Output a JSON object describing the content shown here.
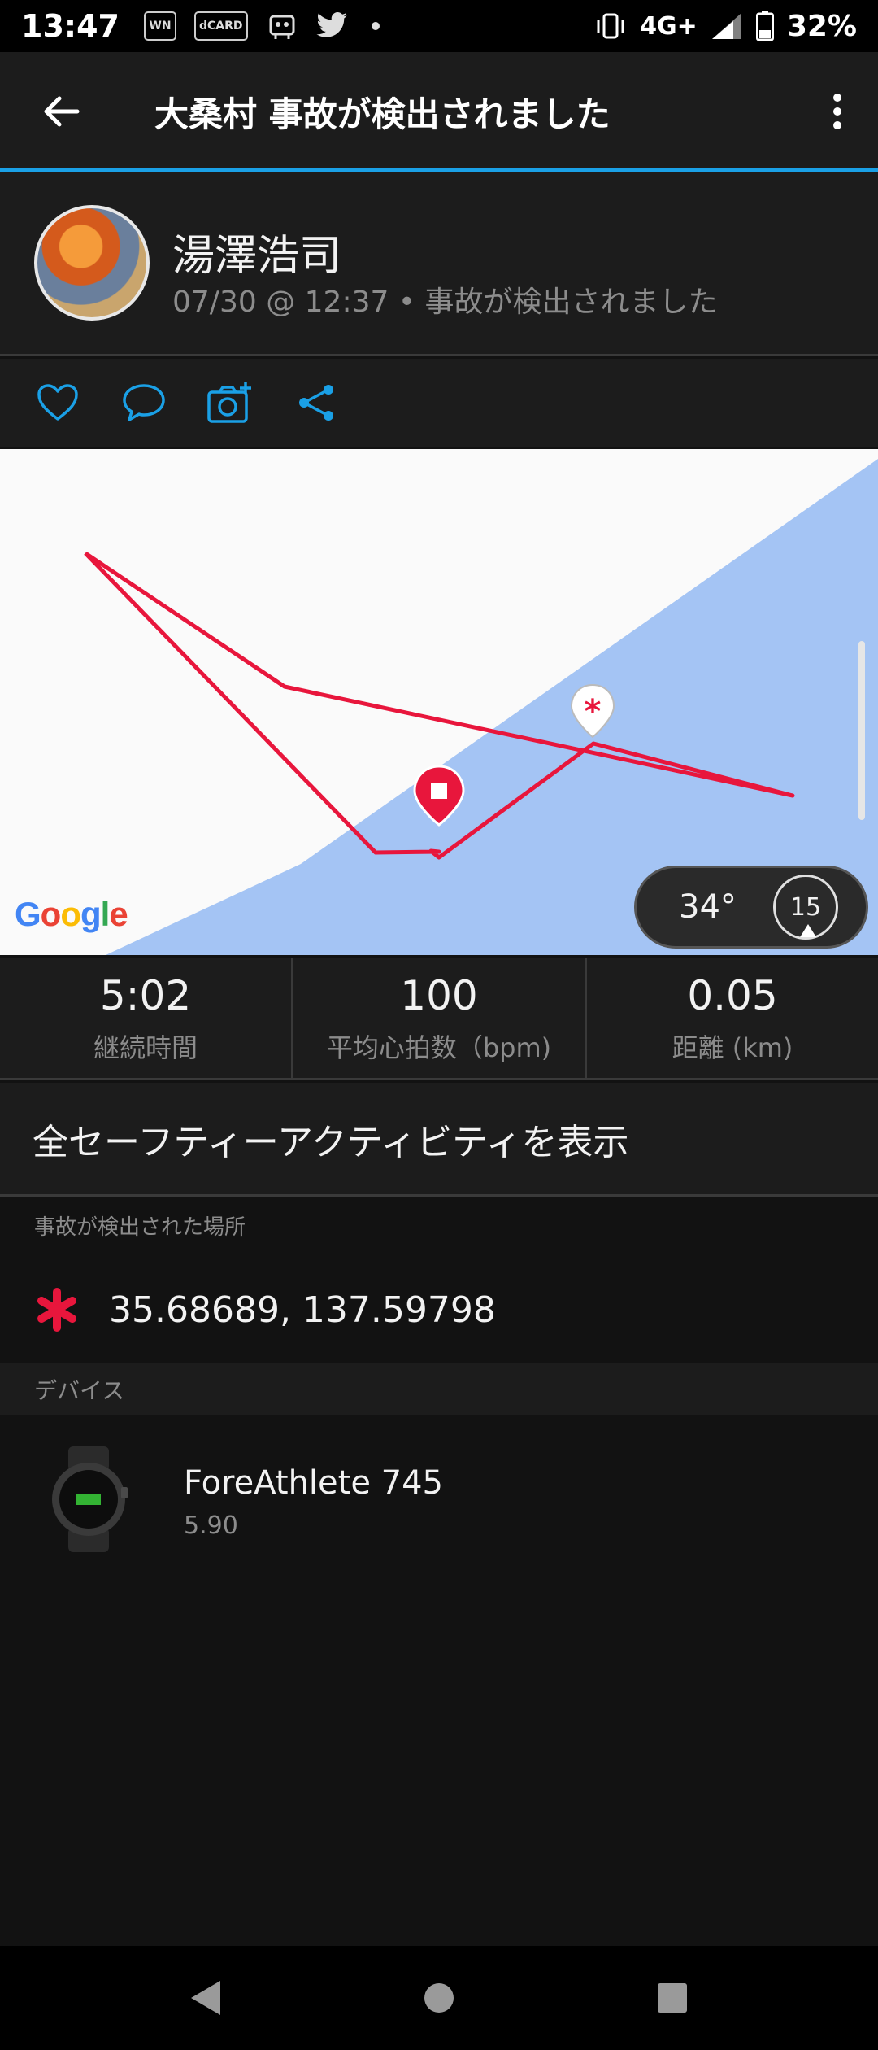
{
  "status": {
    "time": "13:47",
    "left_badges": [
      "WN",
      "dCARD"
    ],
    "network": "4G+",
    "battery": "32%"
  },
  "app_bar": {
    "title": "大桑村 事故が検出されました"
  },
  "profile": {
    "name": "湯澤浩司",
    "subtitle": "07/30 @ 12:37 • 事故が検出されました"
  },
  "map": {
    "logo_text": "Google",
    "temperature": "34°",
    "wind_speed": "15"
  },
  "stats": [
    {
      "value": "5:02",
      "label": "継続時間"
    },
    {
      "value": "100",
      "label": "平均心拍数（bpm)"
    },
    {
      "value": "0.05",
      "label": "距離 (km)"
    }
  ],
  "view_all_label": "全セーフティーアクティビティを表示",
  "location": {
    "section_label": "事故が検出された場所",
    "coords": "35.68689, 137.59798"
  },
  "device": {
    "section_label": "デバイス",
    "name": "ForeAthlete 745",
    "version": "5.90"
  },
  "colors": {
    "accent": "#1aa0e6",
    "route": "#e8163c",
    "water": "#a4c4f4"
  },
  "icons": [
    "back-arrow-icon",
    "more-vert-icon",
    "heart-icon",
    "comment-icon",
    "add-photo-icon",
    "share-icon",
    "incident-asterisk-icon",
    "stop-marker-icon",
    "wind-compass-icon",
    "nav-back-icon",
    "nav-home-icon",
    "nav-recents-icon"
  ]
}
